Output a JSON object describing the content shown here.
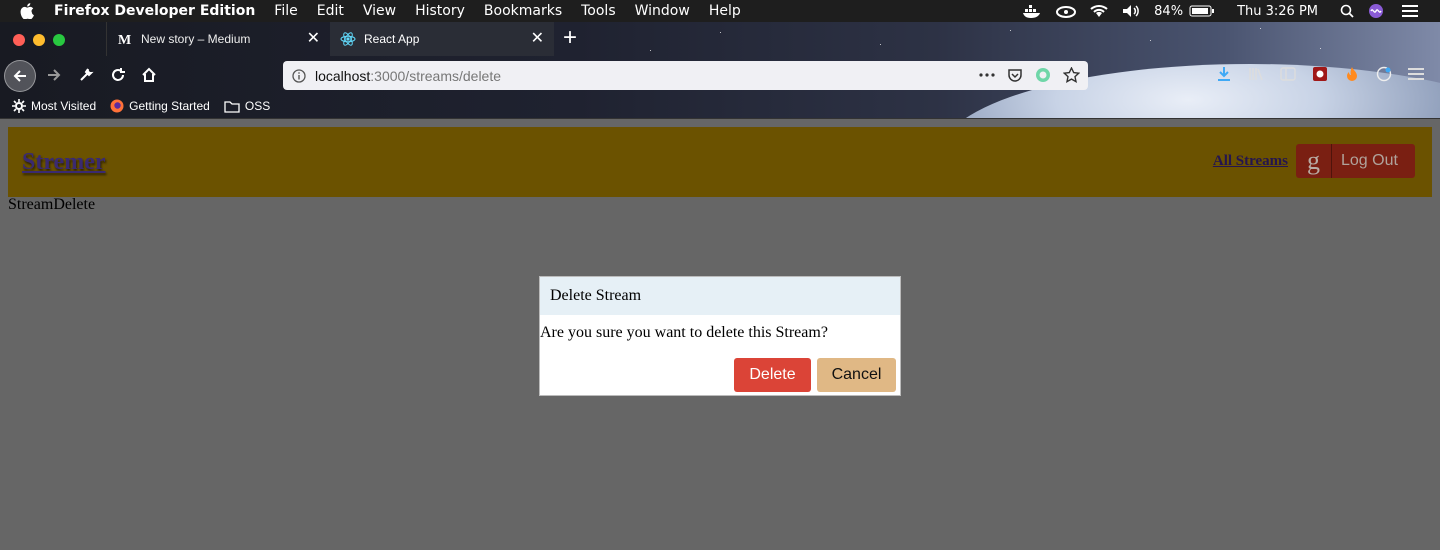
{
  "menubar": {
    "app_name": "Firefox Developer Edition",
    "items": [
      "File",
      "Edit",
      "View",
      "History",
      "Bookmarks",
      "Tools",
      "Window",
      "Help"
    ],
    "battery": "84%",
    "clock": "Thu 3:26 PM"
  },
  "tabs": [
    {
      "title": "New story – Medium",
      "icon": "medium-icon",
      "active": false
    },
    {
      "title": "React App",
      "icon": "react-icon",
      "active": true
    }
  ],
  "urlbar": {
    "host": "localhost",
    "path": ":3000/streams/delete"
  },
  "bookmarks": [
    {
      "label": "Most Visited",
      "icon": "gear-icon"
    },
    {
      "label": "Getting Started",
      "icon": "firefox-icon"
    },
    {
      "label": "OSS",
      "icon": "folder-icon"
    }
  ],
  "app": {
    "brand": "Stremer",
    "nav_all_streams": "All Streams",
    "logout_label": "Log Out",
    "logout_icon_letter": "g",
    "page_heading": "StreamDelete"
  },
  "modal": {
    "title": "Delete Stream",
    "body": "Are you sure you want to delete this Stream?",
    "delete_label": "Delete",
    "cancel_label": "Cancel"
  },
  "colors": {
    "header_bg": "#6b5200",
    "overlay_bg": "#666666",
    "delete_btn": "#db4437",
    "cancel_btn": "#e0b885",
    "modal_header": "#e6f0f6"
  }
}
